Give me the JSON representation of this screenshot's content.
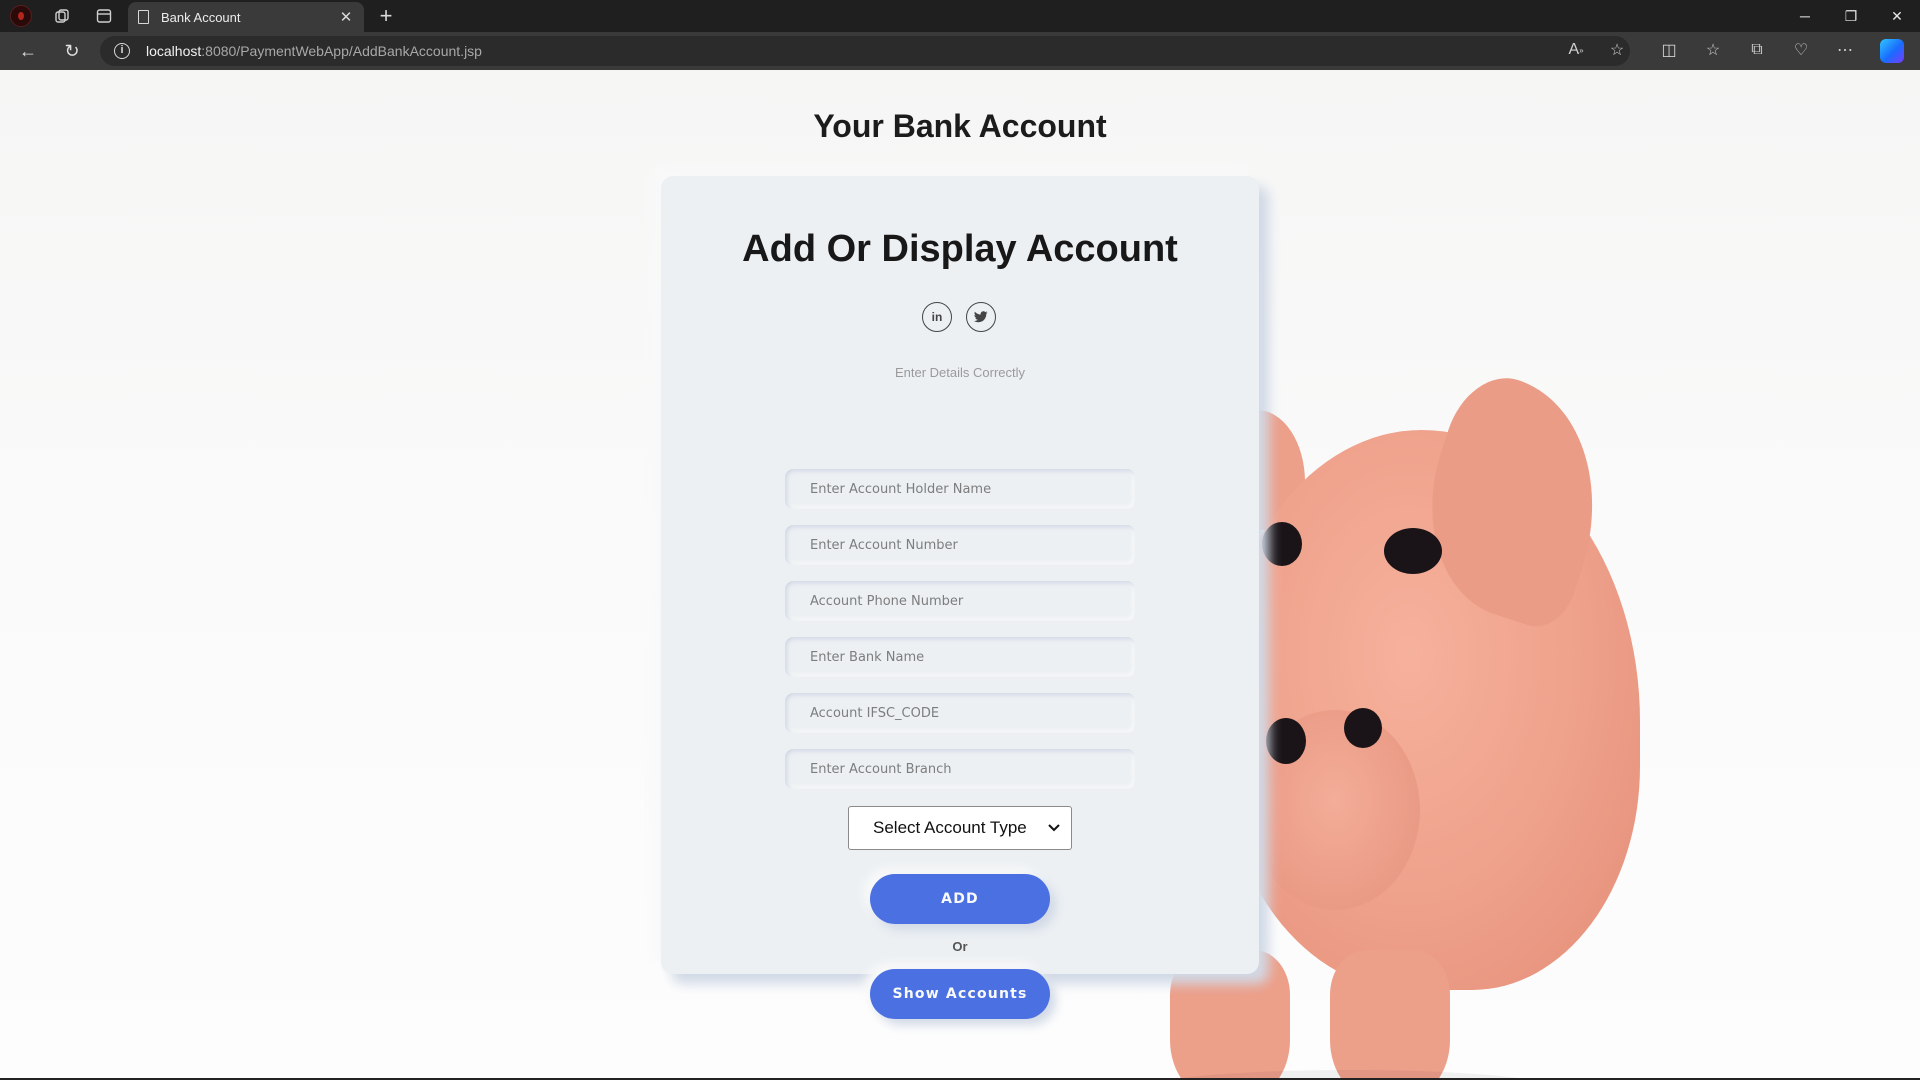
{
  "browser": {
    "tab_title": "Bank Account",
    "url_host": "localhost",
    "url_rest": ":8080/PaymentWebApp/AddBankAccount.jsp"
  },
  "page": {
    "heading": "Your Bank Account"
  },
  "card": {
    "title": "Add Or Display Account",
    "subtitle": "Enter Details Correctly",
    "fields": {
      "holder_name": "Enter Account Holder Name",
      "account_number": "Enter Account Number",
      "phone": "Account Phone Number",
      "bank_name": "Enter Bank Name",
      "ifsc": "Account IFSC_CODE",
      "branch": "Enter Account Branch"
    },
    "account_type_select": "Select Account Type",
    "add_button": "ADD",
    "or_text": "Or",
    "show_button": "Show Accounts"
  },
  "colors": {
    "accent": "#4b70e2",
    "card_bg": "#ecf0f3"
  }
}
